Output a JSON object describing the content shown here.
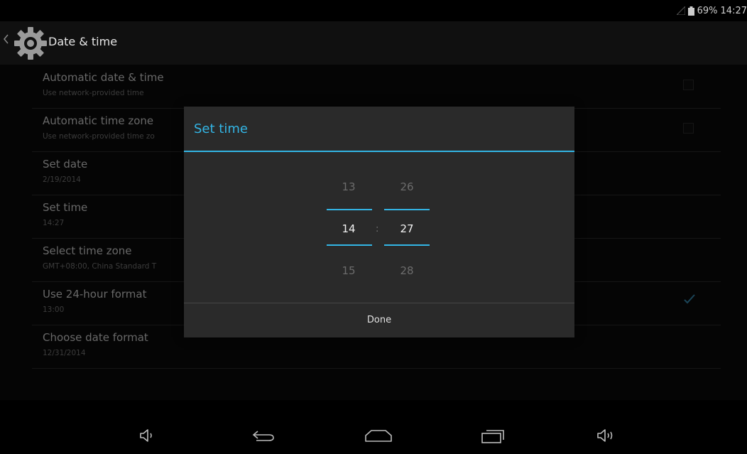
{
  "status_bar": {
    "battery": "69%",
    "time": "14:27"
  },
  "action_bar": {
    "title": "Date & time"
  },
  "settings": [
    {
      "title": "Automatic date & time",
      "summary": "Use network-provided time"
    },
    {
      "title": "Automatic time zone",
      "summary": "Use network-provided time zo"
    },
    {
      "title": "Set date",
      "summary": "2/19/2014"
    },
    {
      "title": "Set time",
      "summary": "14:27"
    },
    {
      "title": "Select time zone",
      "summary": "GMT+08:00, China Standard T"
    },
    {
      "title": "Use 24-hour format",
      "summary": "13:00"
    },
    {
      "title": "Choose date format",
      "summary": "12/31/2014"
    }
  ],
  "dialog": {
    "title": "Set time",
    "hour": {
      "prev": "13",
      "current": "14",
      "next": "15"
    },
    "minute": {
      "prev": "26",
      "current": "27",
      "next": "28"
    },
    "separator": ":",
    "done": "Done"
  },
  "colors": {
    "accent": "#33b5e5",
    "background": "#000000",
    "dialog": "#2a2a2a"
  }
}
